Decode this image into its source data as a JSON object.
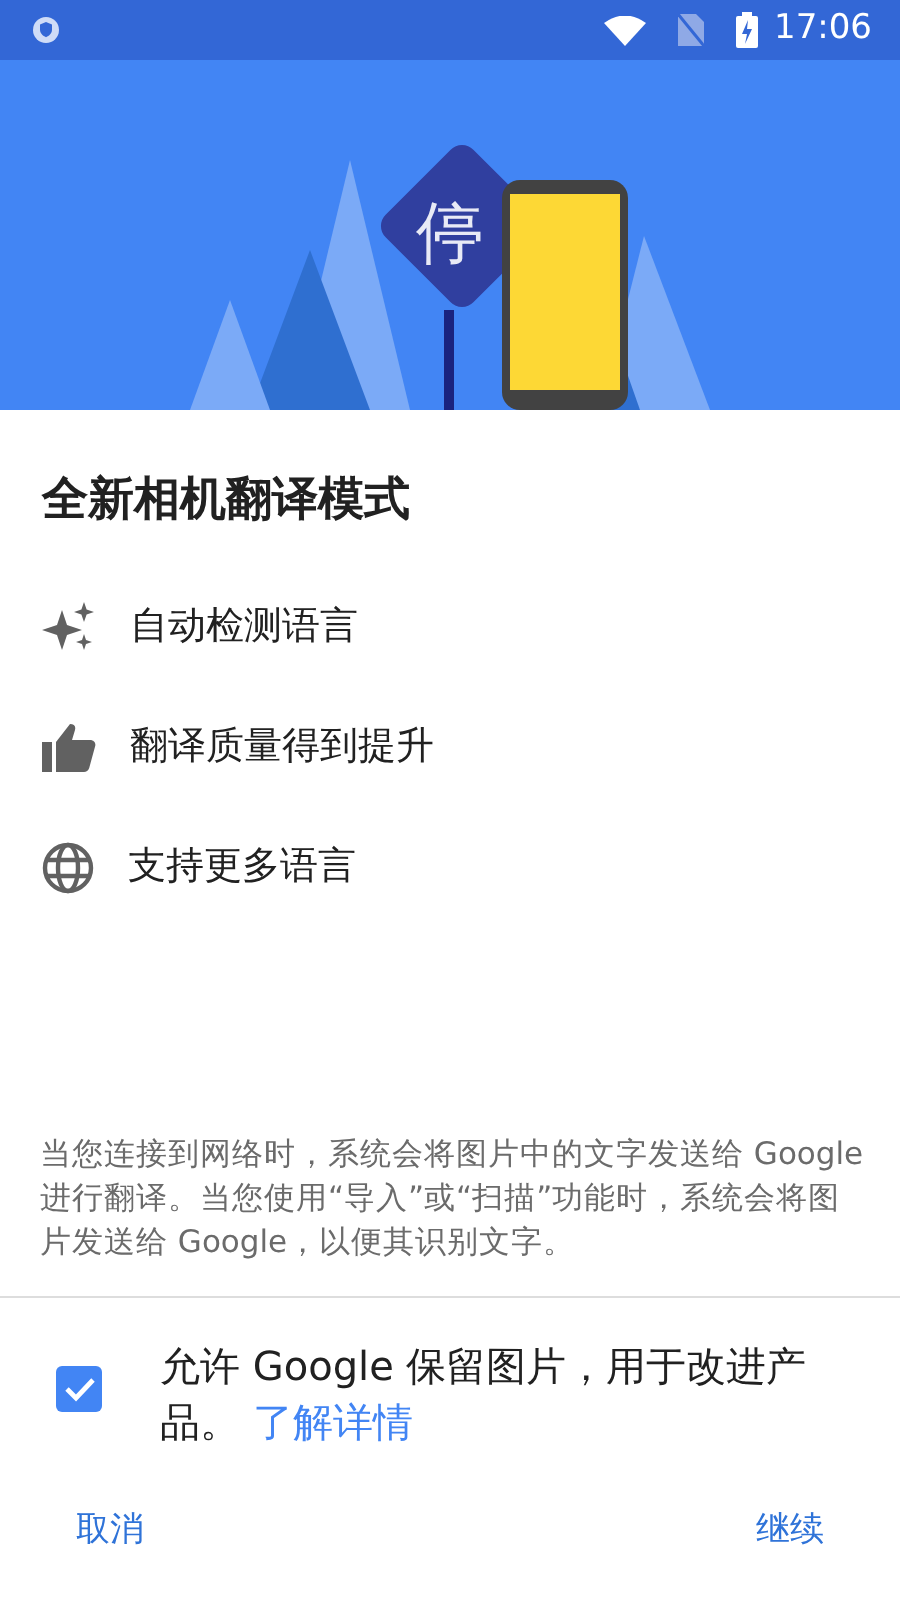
{
  "status_bar": {
    "time": "17:06"
  },
  "hero": {
    "sign_text": "停"
  },
  "title": "全新相机翻译模式",
  "features": [
    {
      "kind": "sparkle",
      "label": "自动检测语言"
    },
    {
      "kind": "thumb",
      "label": "翻译质量得到提升"
    },
    {
      "kind": "globe",
      "label": "支持更多语言"
    }
  ],
  "disclaimer": "当您连接到网络时，系统会将图片中的文字发送给 Google 进行翻译。当您使用“导入”或“扫描”功能时，系统会将图片发送给 Google，以便其识别文字。",
  "consent": {
    "checked": true,
    "text": "允许 Google 保留图片，用于改进产品。",
    "link": "了解详情"
  },
  "buttons": [
    {
      "label": "取消"
    },
    {
      "label": "继续"
    }
  ]
}
